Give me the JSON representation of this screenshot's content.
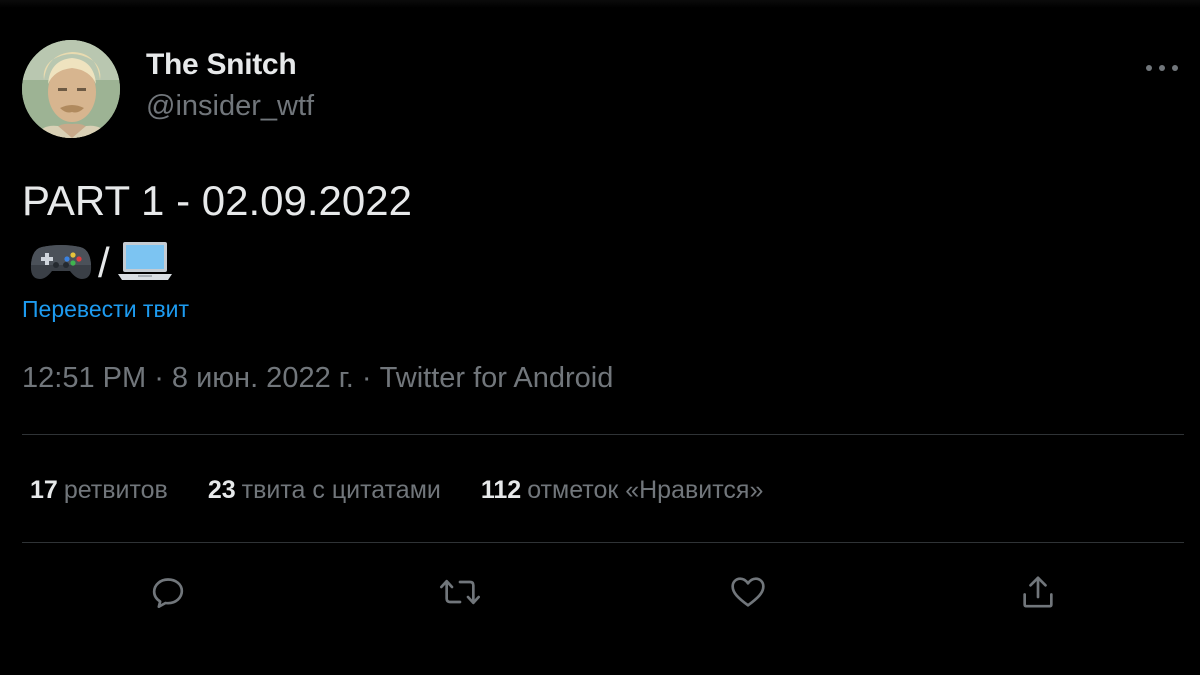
{
  "author": {
    "name": "The Snitch",
    "handle": "@insider_wtf"
  },
  "tweet": {
    "text": "PART 1 - 02.09.2022",
    "emoji_slash": "/",
    "emoji_icons": [
      "gamepad-icon",
      "laptop-icon"
    ],
    "translate_label": "Перевести твит",
    "time": "12:51 PM",
    "date": "8 июн. 2022 г.",
    "source": "Twitter for Android",
    "sep": " · "
  },
  "stats": {
    "retweets": {
      "count": "17",
      "label": "ретвитов"
    },
    "quotes": {
      "count": "23",
      "label": "твита с цитатами"
    },
    "likes": {
      "count": "112",
      "label": "отметок «Нравится»"
    }
  },
  "actions": [
    "reply-icon",
    "retweet-icon",
    "like-icon",
    "share-icon"
  ],
  "colors": {
    "background": "#000000",
    "text": "#e7e9ea",
    "secondary": "#71767b",
    "link": "#1d9bf0",
    "divider": "#2f3336"
  }
}
